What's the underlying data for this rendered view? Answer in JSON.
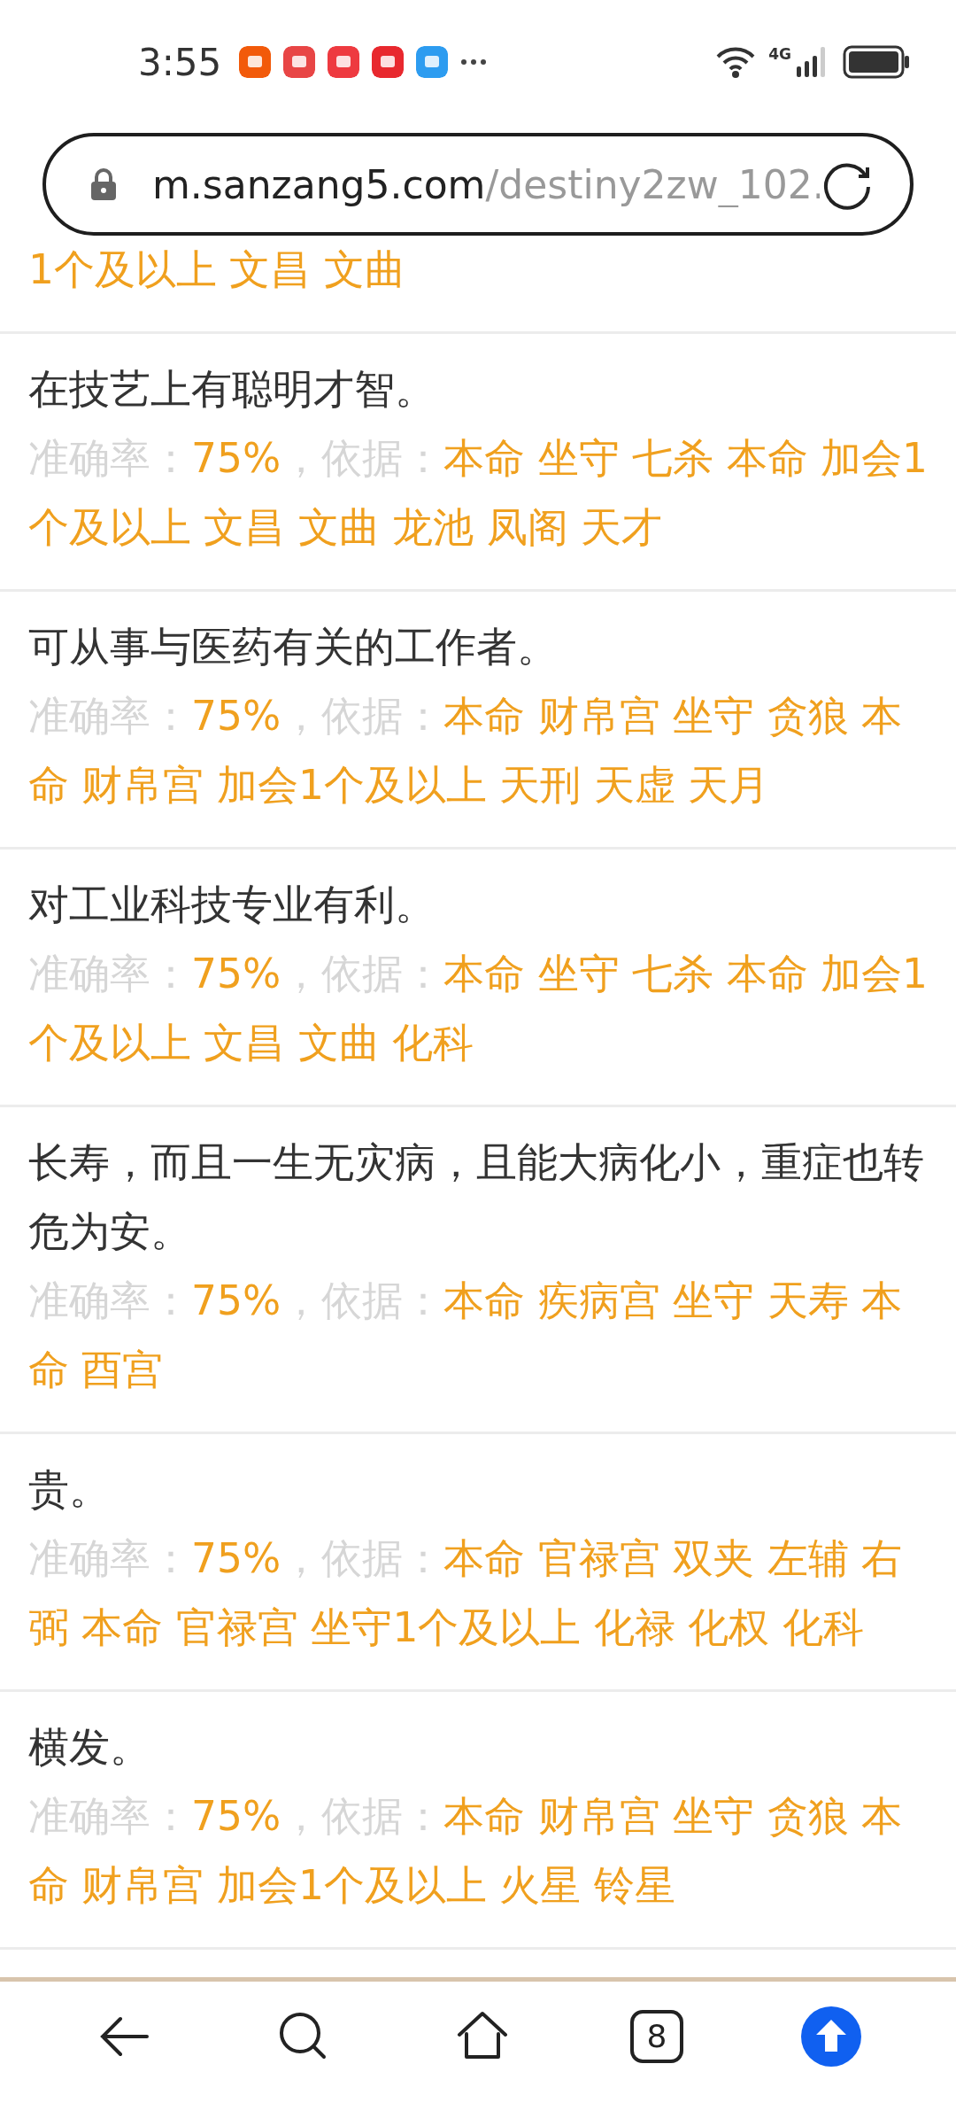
{
  "status_bar": {
    "time": "3:55",
    "notifications": [
      {
        "color": "#f25a0a"
      },
      {
        "color": "#e84545"
      },
      {
        "color": "#ee3a40"
      },
      {
        "color": "#e8282e"
      },
      {
        "color": "#2d9cf0"
      }
    ],
    "network": "4G"
  },
  "address_bar": {
    "domain": "m.sanzang5.com",
    "path": "/destiny2zw_102."
  },
  "results": [
    {
      "basis": "1个及以上 文昌 文曲"
    },
    {
      "description": "在技艺上有聪明才智。",
      "accuracy_label": "准确率：",
      "accuracy": "75%",
      "basis_label": "，依据：",
      "basis": "本命 坐守 七杀 本命 加会1个及以上 文昌 文曲 龙池 凤阁 天才"
    },
    {
      "description": "可从事与医药有关的工作者。",
      "accuracy_label": "准确率：",
      "accuracy": "75%",
      "basis_label": "，依据：",
      "basis": "本命 财帛宫 坐守 贪狼 本命 财帛宫 加会1个及以上 天刑 天虚 天月"
    },
    {
      "description": "对工业科技专业有利。",
      "accuracy_label": "准确率：",
      "accuracy": "75%",
      "basis_label": "，依据：",
      "basis": "本命 坐守 七杀 本命 加会1个及以上 文昌 文曲 化科"
    },
    {
      "description": "长寿，而且一生无灾病，且能大病化小，重症也转危为安。",
      "accuracy_label": "准确率：",
      "accuracy": "75%",
      "basis_label": "，依据：",
      "basis": "本命 疾病宫 坐守 天寿 本命 酉宫"
    },
    {
      "description": "贵。",
      "accuracy_label": "准确率：",
      "accuracy": "75%",
      "basis_label": "，依据：",
      "basis": "本命 官禄宫 双夹 左辅 右弼 本命 官禄宫 坐守1个及以上 化禄 化权 化科"
    },
    {
      "description": "横发。",
      "accuracy_label": "准确率：",
      "accuracy": "75%",
      "basis_label": "，依据：",
      "basis": "本命 财帛宫 坐守 贪狼 本命 财帛宫 加会1个及以上 火星 铃星"
    }
  ],
  "bottom_nav": {
    "tab_count": "8"
  }
}
